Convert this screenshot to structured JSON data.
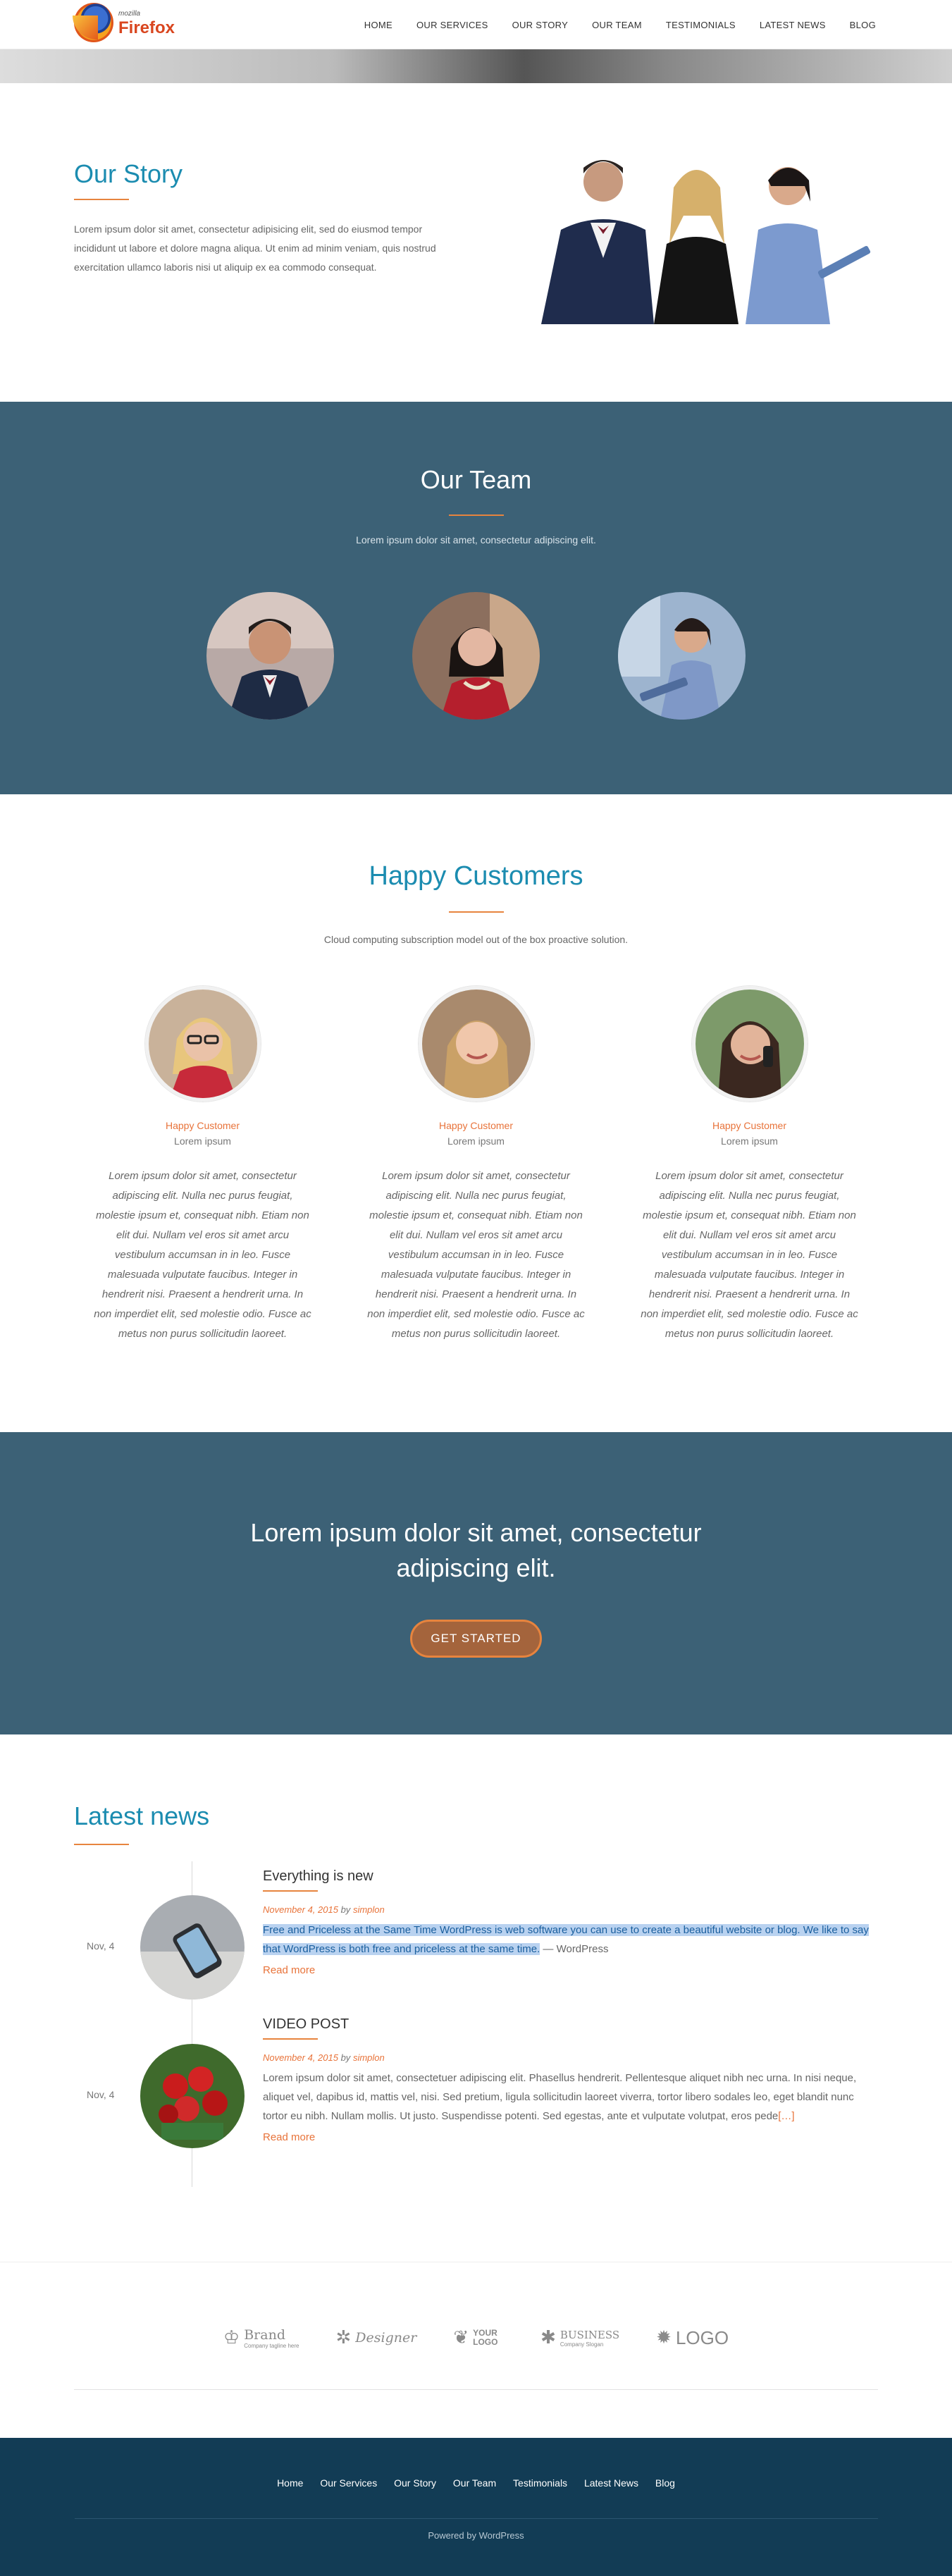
{
  "header": {
    "logo_small": "mozilla",
    "logo_big": "Firefox",
    "nav": [
      "HOME",
      "OUR SERVICES",
      "OUR STORY",
      "OUR TEAM",
      "TESTIMONIALS",
      "LATEST NEWS",
      "BLOG"
    ]
  },
  "story": {
    "title": "Our Story",
    "text": "Lorem ipsum dolor sit amet, consectetur adipisicing elit, sed do eiusmod tempor incididunt ut labore et dolore magna aliqua. Ut enim ad minim veniam, quis nostrud exercitation ullamco laboris nisi ut aliquip ex ea commodo consequat."
  },
  "team": {
    "title": "Our Team",
    "subtitle": "Lorem ipsum dolor sit amet, consectetur adipiscing elit."
  },
  "customers": {
    "title": "Happy Customers",
    "subtitle": "Cloud computing subscription model out of the box proactive solution.",
    "items": [
      {
        "role": "Happy Customer",
        "name": "Lorem ipsum",
        "quote": "Lorem ipsum dolor sit amet, consectetur adipiscing elit. Nulla nec purus feugiat, molestie ipsum et, consequat nibh. Etiam non elit dui. Nullam vel eros sit amet arcu vestibulum accumsan in in leo. Fusce malesuada vulputate faucibus. Integer in hendrerit nisi. Praesent a hendrerit urna. In non imperdiet elit, sed molestie odio. Fusce ac metus non purus sollicitudin laoreet."
      },
      {
        "role": "Happy Customer",
        "name": "Lorem ipsum",
        "quote": "Lorem ipsum dolor sit amet, consectetur adipiscing elit. Nulla nec purus feugiat, molestie ipsum et, consequat nibh. Etiam non elit dui. Nullam vel eros sit amet arcu vestibulum accumsan in in leo. Fusce malesuada vulputate faucibus. Integer in hendrerit nisi. Praesent a hendrerit urna. In non imperdiet elit, sed molestie odio. Fusce ac metus non purus sollicitudin laoreet."
      },
      {
        "role": "Happy Customer",
        "name": "Lorem ipsum",
        "quote": "Lorem ipsum dolor sit amet, consectetur adipiscing elit. Nulla nec purus feugiat, molestie ipsum et, consequat nibh. Etiam non elit dui. Nullam vel eros sit amet arcu vestibulum accumsan in in leo. Fusce malesuada vulputate faucibus. Integer in hendrerit nisi. Praesent a hendrerit urna. In non imperdiet elit, sed molestie odio. Fusce ac metus non purus sollicitudin laoreet."
      }
    ]
  },
  "cta": {
    "heading": "Lorem ipsum dolor sit amet, consectetur adipiscing elit.",
    "button": "GET STARTED"
  },
  "news": {
    "title": "Latest news",
    "posts": [
      {
        "date": "Nov, 4",
        "title": "Everything is new",
        "meta_date": "November 4, 2015",
        "meta_by": "by",
        "meta_author": "simplon",
        "excerpt_highlight": "Free and Priceless at the Same Time WordPress is web software you can use to create a beautiful website or blog. We like to say that WordPress is both free and priceless at the same time.",
        "excerpt_tail": " — WordPress",
        "read_more": "Read more"
      },
      {
        "date": "Nov, 4",
        "title": "VIDEO POST",
        "meta_date": "November 4, 2015",
        "meta_by": "by",
        "meta_author": "simplon",
        "excerpt": "Lorem ipsum dolor sit amet, consectetuer adipiscing elit. Phasellus hendrerit. Pellentesque aliquet nibh nec urna. In nisi neque, aliquet vel, dapibus id, mattis vel, nisi. Sed pretium, ligula sollicitudin laoreet viverra, tortor libero sodales leo, eget blandit nunc tortor eu nibh. Nullam mollis. Ut justo. Suspendisse potenti. Sed egestas, ante et vulputate volutpat, eros pede",
        "ellipsis": "[…]",
        "read_more": "Read more"
      }
    ]
  },
  "partners": [
    {
      "icon": "brand-icon",
      "text": "Brand",
      "small": "Company tagline here"
    },
    {
      "icon": "designer-icon",
      "text": "Designer",
      "small": ""
    },
    {
      "icon": "footprint-icon",
      "text": "YOUR LOGO",
      "small": ""
    },
    {
      "icon": "leaf-icon",
      "text": "BUSINESS",
      "small": "Company Slogan"
    },
    {
      "icon": "gear-icon",
      "text": "LOGO",
      "small": ""
    }
  ],
  "footer": {
    "nav": [
      "Home",
      "Our Services",
      "Our Story",
      "Our Team",
      "Testimonials",
      "Latest News",
      "Blog"
    ],
    "powered": "Powered by WordPress"
  },
  "colors": {
    "accent": "#e7843e",
    "title_blue": "#1b8cb0",
    "section_dark": "#3c6176",
    "footer": "#123c55"
  }
}
